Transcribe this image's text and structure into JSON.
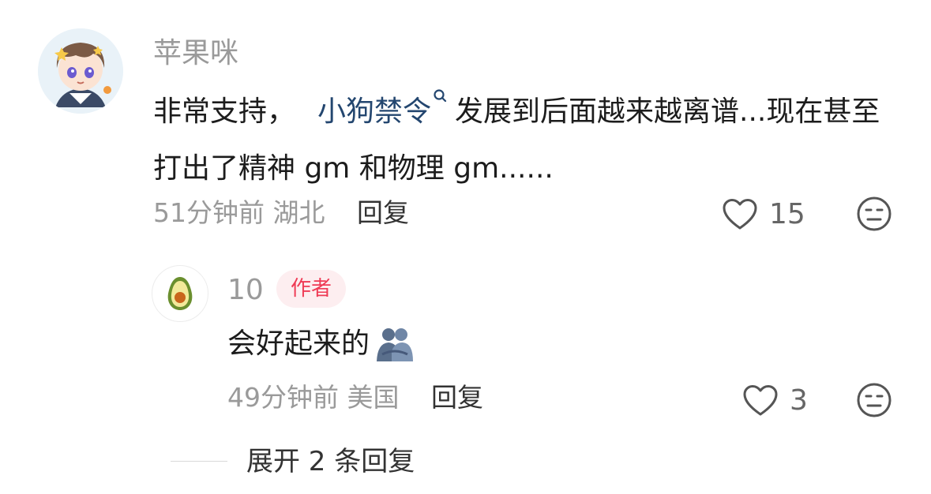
{
  "comment": {
    "username": "苹果咪",
    "text_before": "非常支持，",
    "mention": "小狗禁令",
    "text_after": "发展到后面越来越离谱...现在甚至打出了精神 gm 和物理 gm......",
    "time": "51分钟前",
    "location": "湖北",
    "reply_label": "回复",
    "like_count": "15",
    "like_icon": "heart-outline-icon",
    "dislike_icon": "meh-face-icon"
  },
  "reply": {
    "username": "10",
    "author_badge": "作者",
    "text": "会好起来的",
    "emoji": "people-hugging-emoji",
    "time": "49分钟前",
    "location": "美国",
    "reply_label": "回复",
    "like_count": "3"
  },
  "expand": {
    "label": "展开 2 条回复"
  },
  "colors": {
    "mention": "#23466f",
    "badge_text": "#ef3b55",
    "badge_bg": "#fdeef0",
    "meta": "#9a9a9a"
  }
}
